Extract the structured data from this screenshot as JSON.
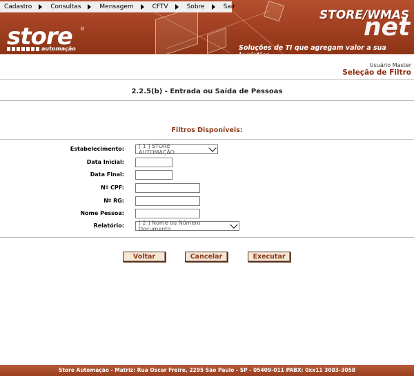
{
  "menu": {
    "items": [
      {
        "label": "Cadastro",
        "arrow": true
      },
      {
        "label": "Consultas",
        "arrow": true
      },
      {
        "label": "Mensagem",
        "arrow": true
      },
      {
        "label": "CFTV",
        "arrow": true
      },
      {
        "label": "Sobre",
        "arrow": true
      },
      {
        "label": "Sair",
        "arrow": false
      }
    ]
  },
  "header": {
    "logo_text": "store",
    "logo_registered": "®",
    "logo_sub": "automação",
    "brand_line1": "STORE/WMAS",
    "brand_line2": "net",
    "tagline": "Soluções de TI que agregam valor a sua logística",
    "colors": {
      "banner": "#a34123",
      "accent": "#8a2e10"
    }
  },
  "user": {
    "name": "Usuário Master",
    "screen": "Seleção de Filtro"
  },
  "report": {
    "title": "2.2.5(b) - Entrada ou Saída de Pessoas"
  },
  "filters": {
    "title": "Filtros Disponíveis:",
    "estabelecimento": {
      "label": "Estabelecimento:",
      "value": "[ 1 ] STORE AUTOMAÇÃO"
    },
    "data_inicial": {
      "label": "Data Inicial:",
      "value": ""
    },
    "data_final": {
      "label": "Data Final:",
      "value": ""
    },
    "cpf": {
      "label": "Nº CPF:",
      "value": ""
    },
    "rg": {
      "label": "Nº RG:",
      "value": ""
    },
    "nome": {
      "label": "Nome Pessoa:",
      "value": ""
    },
    "relatorio": {
      "label": "Relatório:",
      "value": "[ 2 ] Nome ou Número Documento"
    }
  },
  "buttons": {
    "voltar": "Voltar",
    "cancelar": "Cancelar",
    "executar": "Executar"
  },
  "footer": {
    "text": "Store Automação - Matriz: Rua Oscar Freire, 2295 São Paulo - SP - 05409-011 PABX: 0xx11 3083-3058"
  }
}
